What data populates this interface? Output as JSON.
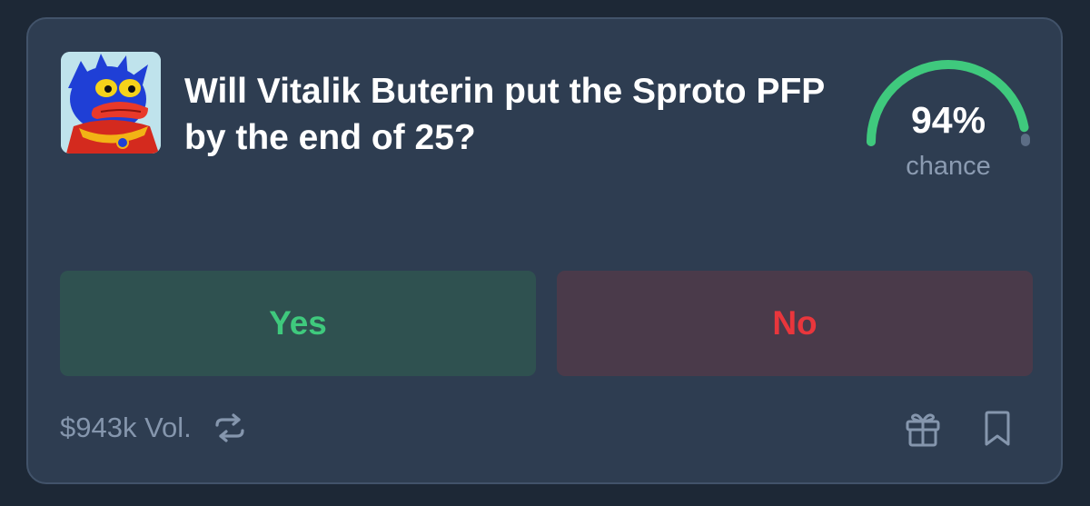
{
  "market": {
    "question": "Will Vitalik Buterin put the Sproto PFP by the end of 25?",
    "avatar_icon": "sproto-character-avatar"
  },
  "gauge": {
    "value_text": "94%",
    "value_fraction": 0.94,
    "label": "chance",
    "fill_color": "#3fc97d",
    "track_color": "#5c6d85"
  },
  "actions": {
    "yes_label": "Yes",
    "no_label": "No"
  },
  "footer": {
    "volume": "$943k Vol.",
    "repeat_icon": "repeat-icon",
    "gift_icon": "gift-icon",
    "bookmark_icon": "bookmark-icon"
  },
  "colors": {
    "yes": "#3fc97d",
    "no": "#e9363c",
    "card": "#2e3d51",
    "background": "#1d2836"
  }
}
